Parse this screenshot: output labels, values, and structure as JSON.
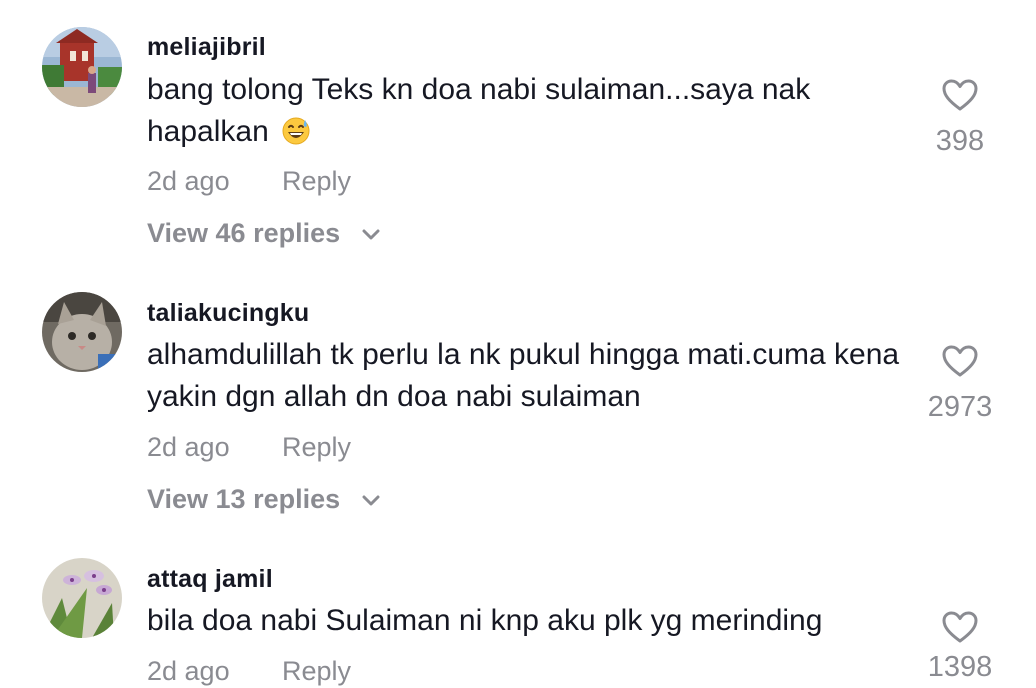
{
  "comments": [
    {
      "username": "meliajibril",
      "text": "bang tolong Teks kn doa nabi sulaiman...saya nak hapalkan",
      "emoji": "grinning-face-with-sweat",
      "time": "2d ago",
      "reply_label": "Reply",
      "likes": "398",
      "view_replies": "View 46 replies",
      "avatar": "building-photo"
    },
    {
      "username": "taliakucingku",
      "text": "alhamdulillah tk perlu la nk pukul hingga mati.cuma kena yakin dgn allah dn doa nabi sulaiman",
      "time": "2d ago",
      "reply_label": "Reply",
      "likes": "2973",
      "view_replies": "View 13 replies",
      "avatar": "kitten-photo"
    },
    {
      "username": "attaq jamil",
      "text": "bila doa nabi Sulaiman ni knp aku plk yg merinding",
      "time": "2d ago",
      "reply_label": "Reply",
      "likes": "1398",
      "avatar": "orchid-photo"
    }
  ],
  "colors": {
    "primary_text": "#161823",
    "secondary_text": "#8a8b91",
    "heart_outline": "#8a8b91"
  },
  "icons": [
    "heart-outline-icon",
    "chevron-down-icon",
    "grinning-face-with-sweat-emoji"
  ]
}
